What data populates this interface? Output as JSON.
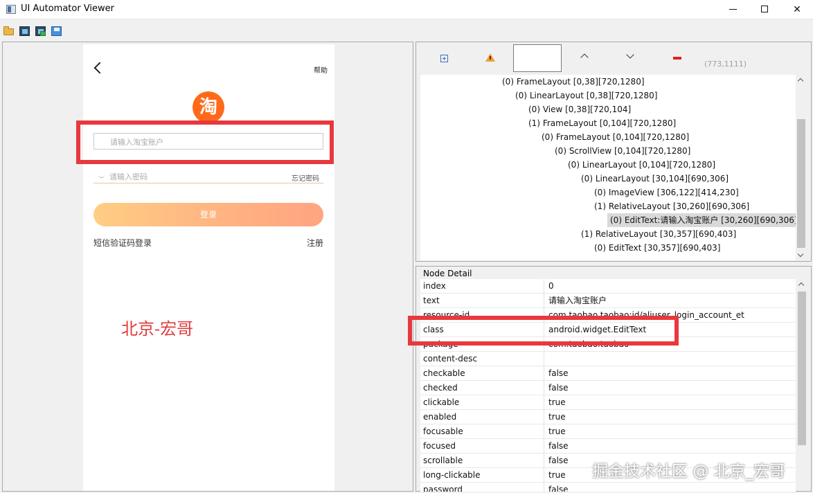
{
  "window": {
    "title": "UI Automator Viewer"
  },
  "toolbar": {
    "icons": [
      "folder-open-icon",
      "device-screenshot-icon",
      "device-screenshot-compressed-icon",
      "save-icon"
    ]
  },
  "device": {
    "help_label": "帮助",
    "logo_text": "淘",
    "account_placeholder": "请输入淘宝账户",
    "password_placeholder": "请输入密码",
    "forgot_password_label": "忘记密码",
    "login_label": "登录",
    "sms_login_label": "短信验证码登录",
    "register_label": "注册"
  },
  "annotation": {
    "text": "北京-宏哥",
    "color": "#e03c3c"
  },
  "inspector_toolbar": {
    "icons": [
      "expand-all-icon",
      "warning-icon",
      "search-box",
      "prev-result-icon",
      "next-result-icon",
      "clear-icon"
    ],
    "coordinates": "(773,1111)"
  },
  "tree": {
    "nodes": [
      {
        "label": "(0) FrameLayout [0,38][720,1280]",
        "depth": 0
      },
      {
        "label": "(0) LinearLayout [0,38][720,1280]",
        "depth": 1
      },
      {
        "label": "(0) View [0,38][720,104]",
        "depth": 2
      },
      {
        "label": "(1) FrameLayout [0,104][720,1280]",
        "depth": 2
      },
      {
        "label": "(0) FrameLayout [0,104][720,1280]",
        "depth": 3
      },
      {
        "label": "(0) ScrollView [0,104][720,1280]",
        "depth": 4
      },
      {
        "label": "(0) LinearLayout [0,104][720,1280]",
        "depth": 5
      },
      {
        "label": "(0) LinearLayout [30,104][690,306]",
        "depth": 6
      },
      {
        "label": "(0) ImageView [306,122][414,230]",
        "depth": 7
      },
      {
        "label": "(1) RelativeLayout [30,260][690,306]",
        "depth": 7
      },
      {
        "label": "(0) EditText:请输入淘宝账户 [30,260][690,306]",
        "depth": 8,
        "selected": true
      },
      {
        "label": "(1) RelativeLayout [30,357][690,403]",
        "depth": 6
      },
      {
        "label": "(0) EditText [30,357][690,403]",
        "depth": 7
      }
    ]
  },
  "node_detail": {
    "title": "Node Detail",
    "rows": [
      {
        "key": "index",
        "value": "0"
      },
      {
        "key": "text",
        "value": "请输入淘宝账户"
      },
      {
        "key": "resource-id",
        "value": "com.taobao.taobao:id/aliuser_login_account_et"
      },
      {
        "key": "class",
        "value": "android.widget.EditText"
      },
      {
        "key": "package",
        "value": "com.taobao.taobao"
      },
      {
        "key": "content-desc",
        "value": ""
      },
      {
        "key": "checkable",
        "value": "false"
      },
      {
        "key": "checked",
        "value": "false"
      },
      {
        "key": "clickable",
        "value": "true"
      },
      {
        "key": "enabled",
        "value": "true"
      },
      {
        "key": "focusable",
        "value": "true"
      },
      {
        "key": "focused",
        "value": "false"
      },
      {
        "key": "scrollable",
        "value": "false"
      },
      {
        "key": "long-clickable",
        "value": "true"
      },
      {
        "key": "password",
        "value": "false"
      }
    ]
  },
  "watermark": {
    "text": "掘金技术社区 @ 北京_宏哥"
  }
}
